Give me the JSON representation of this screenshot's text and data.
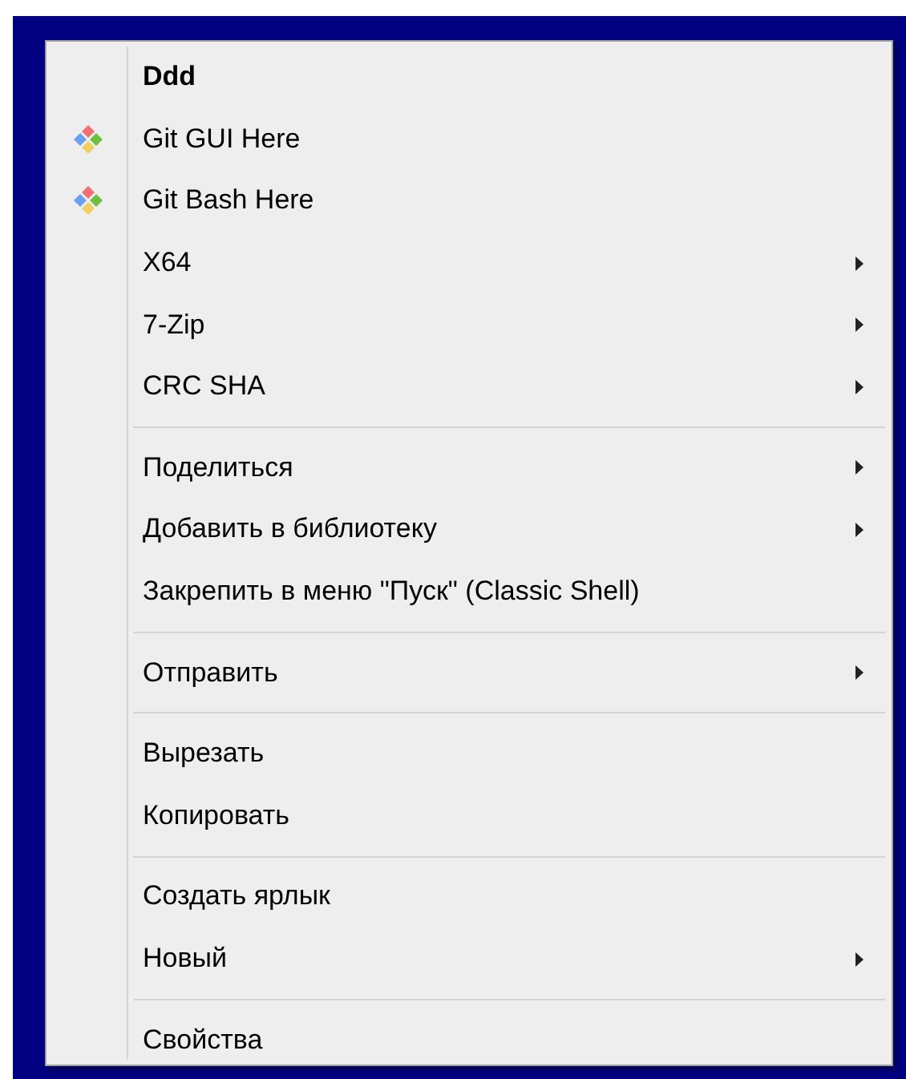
{
  "menu": {
    "groups": [
      {
        "items": [
          {
            "label": "Ddd",
            "kind": "plain",
            "default": true,
            "submenu": false
          },
          {
            "label": "Git GUI Here",
            "kind": "git",
            "default": false,
            "submenu": false
          },
          {
            "label": "Git Bash Here",
            "kind": "git",
            "default": false,
            "submenu": false
          },
          {
            "label": "X64",
            "kind": "plain",
            "default": false,
            "submenu": true
          },
          {
            "label": "7-Zip",
            "kind": "plain",
            "default": false,
            "submenu": true
          },
          {
            "label": "CRC SHA",
            "kind": "plain",
            "default": false,
            "submenu": true
          }
        ]
      },
      {
        "items": [
          {
            "label": "Поделиться",
            "kind": "plain",
            "default": false,
            "submenu": true
          },
          {
            "label": "Добавить в библиотеку",
            "kind": "plain",
            "default": false,
            "submenu": true
          },
          {
            "label": "Закрепить в меню \"Пуск\" (Classic Shell)",
            "kind": "plain",
            "default": false,
            "submenu": false
          }
        ]
      },
      {
        "items": [
          {
            "label": "Отправить",
            "kind": "plain",
            "default": false,
            "submenu": true
          }
        ]
      },
      {
        "items": [
          {
            "label": "Вырезать",
            "kind": "plain",
            "default": false,
            "submenu": false
          },
          {
            "label": "Копировать",
            "kind": "plain",
            "default": false,
            "submenu": false
          }
        ]
      },
      {
        "items": [
          {
            "label": "Создать ярлык",
            "kind": "plain",
            "default": false,
            "submenu": false
          },
          {
            "label": "Новый",
            "kind": "plain",
            "default": false,
            "submenu": true
          }
        ]
      },
      {
        "items": [
          {
            "label": "Свойства",
            "kind": "plain",
            "default": false,
            "submenu": false
          }
        ]
      }
    ]
  }
}
